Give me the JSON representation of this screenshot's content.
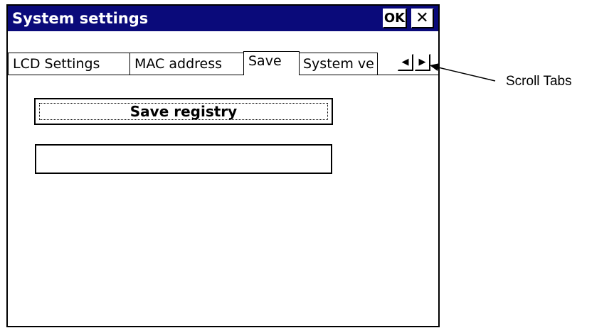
{
  "window": {
    "title": "System settings",
    "ok_label": "OK",
    "close_label": "✕"
  },
  "tabs": [
    {
      "label": "LCD Settings"
    },
    {
      "label": "MAC address"
    },
    {
      "label": "Save",
      "selected": true
    },
    {
      "label": "System ve"
    }
  ],
  "tab_scroll": {
    "left_icon": "◀",
    "right_icon": "▶"
  },
  "save_tab": {
    "save_button_label": "Save registry",
    "status_value": ""
  },
  "annotation": {
    "label": "Scroll Tabs"
  },
  "colors": {
    "titlebar": "#0a0a7a",
    "window_bg": "#ffffff"
  }
}
